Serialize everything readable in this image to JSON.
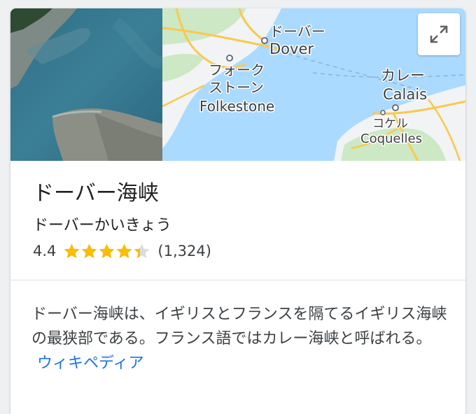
{
  "place": {
    "title": "ドーバー海峡",
    "reading": "ドーバーかいきょう",
    "rating": "4.4",
    "rating_value": 4.4,
    "rating_max": 5,
    "review_count": "(1,324)"
  },
  "map": {
    "labels": {
      "dover_ja": "ドーバー",
      "dover": "Dover",
      "folkestone_ja_1": "フォーク",
      "folkestone_ja_2": "ストーン",
      "folkestone": "Folkestone",
      "calais_ja": "カレー",
      "calais": "Calais",
      "coquelles_ja": "コケル",
      "coquelles": "Coquelles"
    },
    "colors": {
      "sea": "#aadaff",
      "land": "#f1f3f4",
      "park": "#cde8c4",
      "road": "#f9c94d"
    }
  },
  "expand_icon": "expand-arrows-icon",
  "description": {
    "text": "ドーバー海峡は、イギリスとフランスを隔てるイギリス海峡の最狭部である。フランス語ではカレー海峡と呼ばれる。",
    "source_link": "ウィキペディア"
  },
  "colors": {
    "star": "#fbbc04",
    "star_empty": "#dadce0",
    "link": "#1a73e8"
  }
}
